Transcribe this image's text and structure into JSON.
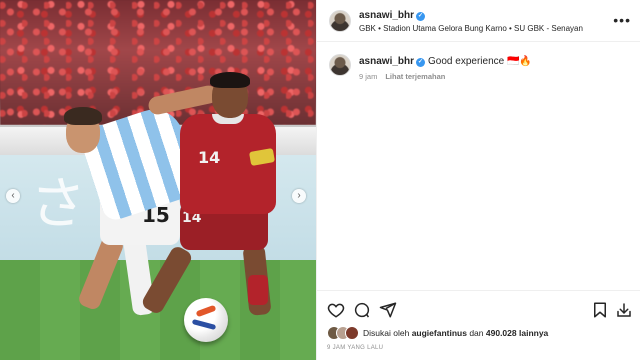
{
  "post": {
    "username": "asnawi_bhr",
    "location": "GBK • Stadion Utama Gelora Bung Karno • SU GBK - Senayan",
    "more_label": "•••",
    "photo": {
      "shirt_number_argentina": "15",
      "shirt_number_indonesia": "14",
      "shorts_number_indonesia": "14",
      "ad_board_text": "さい"
    },
    "carousel": {
      "prev_label": "‹",
      "next_label": "›"
    }
  },
  "caption": {
    "username": "asnawi_bhr",
    "text": "Good experience 🇮🇩🔥",
    "time_ago": "9 jam",
    "translate_label": "Lihat terjemahan"
  },
  "actions": {
    "icons": [
      "heart-icon",
      "comment-icon",
      "share-icon",
      "bookmark-icon",
      "download-icon"
    ]
  },
  "likes": {
    "prefix": "Disukai oleh",
    "user": "augiefantinus",
    "conjunction": "dan",
    "count": "490.028",
    "suffix": "lainnya"
  },
  "timestamp": "9 JAM YANG LALU",
  "colors": {
    "verified": "#3897f0",
    "text": "#262626",
    "muted": "#8e8e8e",
    "indonesia_red": "#b3232b"
  }
}
